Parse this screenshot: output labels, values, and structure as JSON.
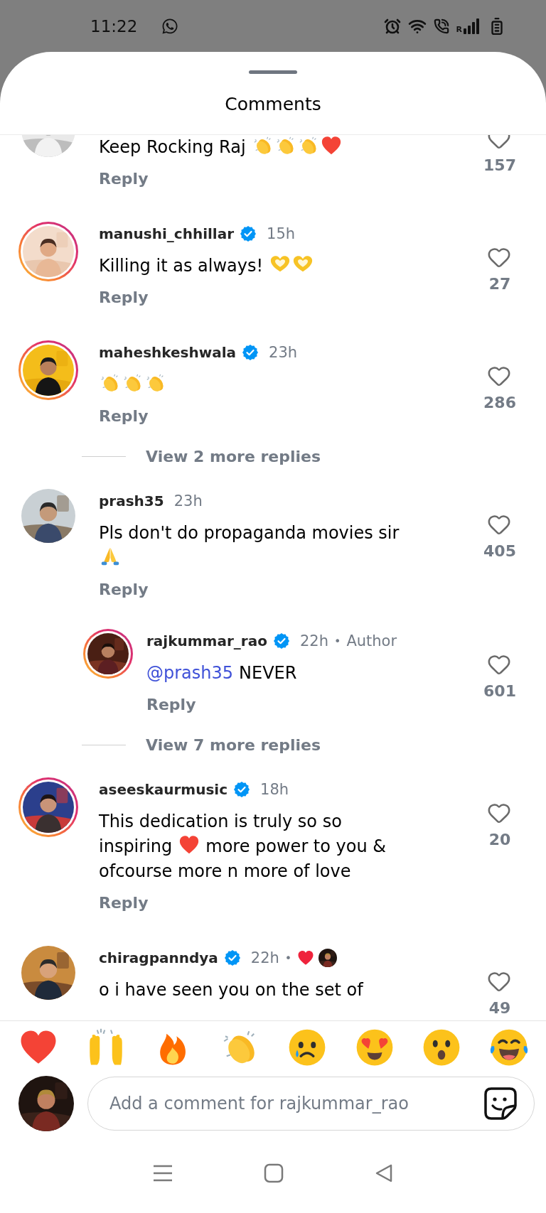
{
  "status_bar": {
    "time": "11:22",
    "network_label": "R"
  },
  "sheet": {
    "title": "Comments"
  },
  "threads": [
    {
      "comment": {
        "story_ring": false,
        "body": [
          {
            "kind": "text",
            "text": "Keep Rocking Raj"
          },
          {
            "kind": "clap"
          },
          {
            "kind": "clap"
          },
          {
            "kind": "clap"
          },
          {
            "kind": "heart"
          }
        ],
        "reply_label": "Reply",
        "likes": "157"
      }
    },
    {
      "comment": {
        "username": "manushi_chhillar",
        "verified": true,
        "time": "15h",
        "story_ring": true,
        "body": [
          {
            "kind": "text",
            "text": "Killing it as always!"
          },
          {
            "kind": "heart-hands"
          },
          {
            "kind": "heart-hands"
          }
        ],
        "reply_label": "Reply",
        "likes": "27"
      }
    },
    {
      "comment": {
        "username": "maheshkeshwala",
        "verified": true,
        "time": "23h",
        "story_ring": true,
        "body": [
          {
            "kind": "clap"
          },
          {
            "kind": "clap"
          },
          {
            "kind": "clap"
          }
        ],
        "reply_label": "Reply",
        "likes": "286"
      },
      "view_more": "View 2 more replies"
    },
    {
      "comment": {
        "username": "prash35",
        "time": "23h",
        "story_ring": false,
        "body": [
          {
            "kind": "text",
            "text": "Pls don't do propaganda movies sir"
          },
          {
            "kind": "pray"
          }
        ],
        "reply_label": "Reply",
        "likes": "405"
      },
      "replies": [
        {
          "username": "rajkummar_rao",
          "verified": true,
          "time": "22h",
          "separator": "•",
          "badge": "Author",
          "story_ring": true,
          "body": [
            {
              "kind": "mention",
              "text": "@prash35"
            },
            {
              "kind": "text",
              "text": "NEVER"
            }
          ],
          "reply_label": "Reply",
          "likes": "601"
        }
      ],
      "view_more": "View 7 more replies"
    },
    {
      "comment": {
        "username": "aseeskaurmusic",
        "verified": true,
        "time": "18h",
        "story_ring": true,
        "body": [
          {
            "kind": "text",
            "text": "This dedication is truly so so"
          },
          {
            "kind": "text",
            "text": "inspiring"
          },
          {
            "kind": "heart"
          },
          {
            "kind": "text",
            "text": "more power to you &"
          },
          {
            "kind": "text",
            "text": "ofcourse more n more of love"
          }
        ],
        "reply_label": "Reply",
        "likes": "20"
      }
    },
    {
      "comment": {
        "username": "chiragpanndya",
        "verified": true,
        "time": "22h",
        "separator": "•",
        "liked_by_author": true,
        "story_ring": false,
        "body": [
          {
            "kind": "text",
            "text": "o i have seen you on the set of"
          }
        ],
        "likes": "49"
      }
    }
  ],
  "reactions": [
    {
      "kind": "heart"
    },
    {
      "kind": "raised-hands"
    },
    {
      "kind": "fire"
    },
    {
      "kind": "clap"
    },
    {
      "kind": "crying"
    },
    {
      "kind": "heart-eyes"
    },
    {
      "kind": "surprised"
    },
    {
      "kind": "laughing"
    }
  ],
  "composer": {
    "placeholder": "Add a comment for rajkummar_rao"
  }
}
